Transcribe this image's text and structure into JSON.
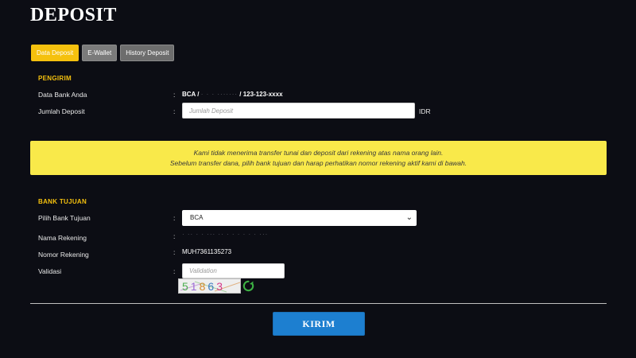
{
  "page": {
    "title": "DEPOSIT"
  },
  "tabs": [
    {
      "label": "Data Deposit",
      "active": true
    },
    {
      "label": "E-Wallet",
      "active": false
    },
    {
      "label": "History Deposit",
      "active": false
    }
  ],
  "sender": {
    "section_title": "PENGIRIM",
    "bank_label": "Data Bank Anda",
    "bank_value_prefix": "BCA /",
    "bank_value_masked": "· · · ·······",
    "bank_value_suffix": "/ 123-123-xxxx",
    "amount_label": "Jumlah Deposit",
    "amount_placeholder": "Jumlah Deposit",
    "amount_unit": "IDR"
  },
  "notice": {
    "line1": "Kami tidak menerima transfer tunai dan deposit dari rekening atas nama orang lain.",
    "line2": "Sebelum transfer dana, pilih bank tujuan dan harap perhatikan nomor rekening aktif kami di bawah."
  },
  "destination": {
    "section_title": "BANK TUJUAN",
    "bank_label": "Pilih Bank Tujuan",
    "bank_selected": "BCA",
    "account_name_label": "Nama Rekening",
    "account_name_value": "· ·· · · ··· ·· · · · · · · ···",
    "account_number_label": "Nomor Rekening",
    "account_number_value": "MUH7361135273",
    "validation_label": "Validasi",
    "validation_placeholder": "Validation",
    "captcha_text": "51863"
  },
  "colon": ":",
  "submit_label": "KIRIM",
  "icons": {
    "refresh": "refresh-icon",
    "dropdown": "chevron-down-icon"
  },
  "colors": {
    "accent": "#f5c10e",
    "notice_bg": "#f9e94a",
    "button": "#1d7fd0",
    "background": "#0c0d14"
  }
}
